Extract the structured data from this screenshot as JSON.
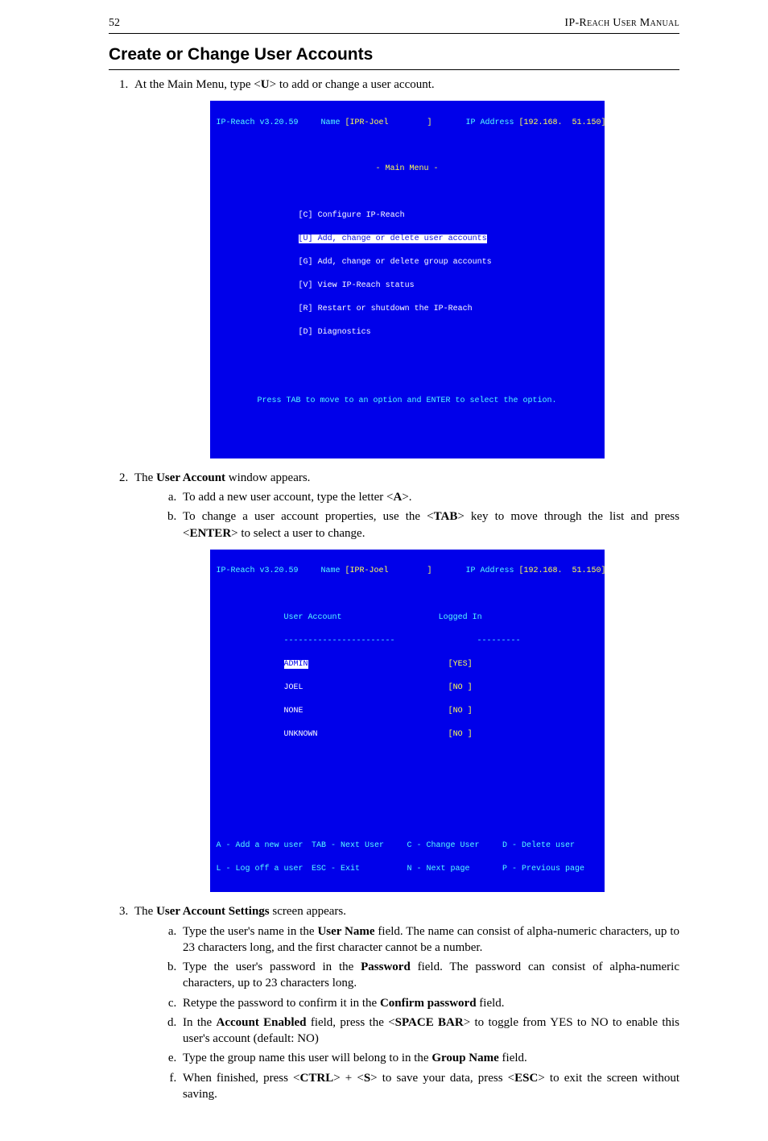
{
  "header": {
    "page": "52",
    "title": "IP-Reach User Manual"
  },
  "section_title": "Create or Change User Accounts",
  "step1_pre": "At the Main Menu, type <",
  "step1_bold": "U",
  "step1_post": "> to add or change a user account.",
  "term1": {
    "version": "IP-Reach v3.20.59",
    "name_label": "Name",
    "name_value": "[IPR-Joel        ]",
    "ip_label": "IP Address",
    "ip_value": "[192.168.  51.150]",
    "menu_title": "- Main Menu -",
    "items": [
      {
        "key": "[C]",
        "label": "Configure IP-Reach",
        "hl": false
      },
      {
        "key": "[U]",
        "label": "Add, change or delete user accounts",
        "hl": true
      },
      {
        "key": "[G]",
        "label": "Add, change or delete group accounts",
        "hl": false
      },
      {
        "key": "[V]",
        "label": "View IP-Reach status",
        "hl": false
      },
      {
        "key": "[R]",
        "label": "Restart or shutdown the IP-Reach",
        "hl": false
      },
      {
        "key": "[D]",
        "label": "Diagnostics",
        "hl": false
      }
    ],
    "footer": "Press TAB to move to an option and ENTER to select the option."
  },
  "step2_pre": "The ",
  "step2_bold": "User Account",
  "step2_post": " window appears.",
  "step2a_pre": "To add a new user account, type the letter <",
  "step2a_bold": "A",
  "step2a_post": ">.",
  "step2b_pre": "To change a user account properties, use the <",
  "step2b_bold1": "TAB",
  "step2b_mid": "> key to move through the list and press <",
  "step2b_bold2": "ENTER",
  "step2b_post": "> to select a user to change.",
  "term2": {
    "version": "IP-Reach v3.20.59",
    "name_label": "Name",
    "name_value": "[IPR-Joel        ]",
    "ip_label": "IP Address",
    "ip_value": "[192.168.  51.150]",
    "col1": "User Account",
    "col2": "Logged In",
    "rule": "-----------------------                 ---------",
    "rows": [
      {
        "name": "ADMIN",
        "status": "[YES]",
        "hl": true
      },
      {
        "name": "JOEL",
        "status": "[NO ]",
        "hl": false
      },
      {
        "name": "NONE",
        "status": "[NO ]",
        "hl": false
      },
      {
        "name": "UNKNOWN",
        "status": "[NO ]",
        "hl": false
      }
    ],
    "foot": {
      "a": "A - Add a new user",
      "b": "TAB - Next User",
      "c": "C - Change User",
      "d": "D - Delete user",
      "e": "L - Log off a user",
      "f": "ESC - Exit",
      "g": "N - Next page",
      "h": "P - Previous page"
    }
  },
  "step3_pre": "The ",
  "step3_bold": "User Account Settings",
  "step3_post": " screen appears.",
  "s3a_1": "Type the user's name in the ",
  "s3a_b": "User Name",
  "s3a_2": " field. The name can consist of alpha-numeric characters, up to 23 characters long, and the first character cannot be a number.",
  "s3b_1": "Type the user's password in the ",
  "s3b_b": "Password",
  "s3b_2": " field. The password can consist of alpha-numeric characters, up to 23 characters long.",
  "s3c_1": "Retype the password to confirm it in the ",
  "s3c_b": "Confirm password",
  "s3c_2": " field.",
  "s3d_1": "In the ",
  "s3d_b1": "Account Enabled",
  "s3d_2": " field, press the <",
  "s3d_b2": "SPACE BAR",
  "s3d_3": "> to toggle from YES to NO to enable this user's account (default: NO)",
  "s3e_1": "Type the group name this user will belong to in the ",
  "s3e_b": "Group Name",
  "s3e_2": " field.",
  "s3f_1": "When finished, press <",
  "s3f_b1": "CTRL",
  "s3f_2": "> + <",
  "s3f_b2": "S",
  "s3f_3": "> to save your data, press <",
  "s3f_b3": "ESC",
  "s3f_4": "> to exit the screen without saving."
}
